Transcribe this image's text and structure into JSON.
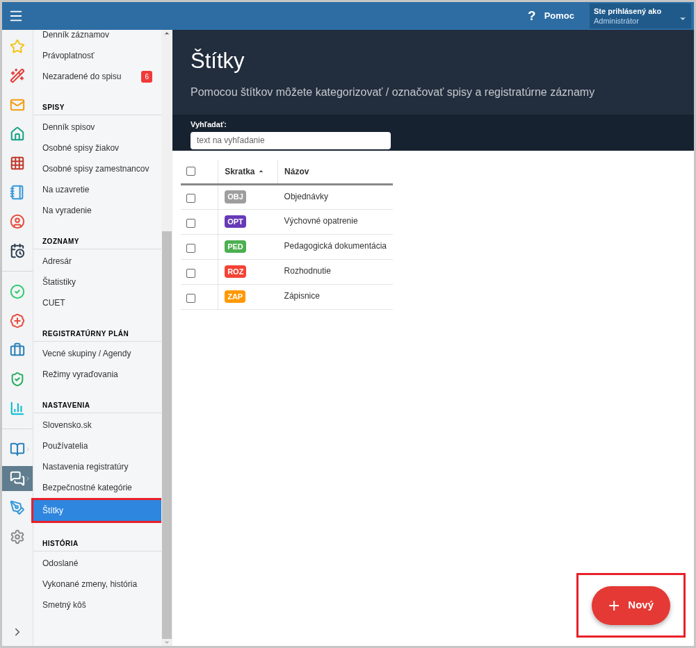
{
  "top_bar": {
    "help": {
      "icon_text": "?",
      "label": "Pomoc"
    },
    "user": {
      "caption": "Ste prihlásený ako",
      "name": "Administrátor"
    }
  },
  "rail": [
    {
      "selected": false,
      "expandable": false
    },
    {
      "selected": false,
      "expandable": false
    },
    {
      "selected": false,
      "expandable": false
    },
    {
      "selected": false,
      "expandable": false
    },
    {
      "selected": false,
      "expandable": false
    },
    {
      "selected": false,
      "expandable": false
    },
    {
      "selected": false,
      "expandable": false
    },
    {
      "selected": false,
      "expandable": false
    },
    {
      "selected": false,
      "expandable": false
    },
    {
      "selected": false,
      "expandable": false
    },
    {
      "selected": false,
      "expandable": false
    },
    {
      "selected": false,
      "expandable": false
    },
    {
      "selected": false,
      "expandable": false
    },
    {
      "selected": false,
      "expandable": true
    },
    {
      "selected": true,
      "expandable": true
    },
    {
      "selected": false,
      "expandable": false
    },
    {
      "selected": false,
      "expandable": false
    }
  ],
  "sidebar": {
    "sections": [
      {
        "items": [
          {
            "label": "Denník záznamov",
            "selected": false,
            "highlighted": false
          },
          {
            "label": "Právoplatnosť",
            "selected": false,
            "highlighted": false
          },
          {
            "label": "Nezaradené do spisu",
            "badge": "6",
            "selected": false,
            "highlighted": false
          }
        ]
      },
      {
        "title": "SPISY",
        "items": [
          {
            "label": "Denník spisov",
            "selected": false,
            "highlighted": false
          },
          {
            "label": "Osobné spisy žiakov",
            "selected": false,
            "highlighted": false
          },
          {
            "label": "Osobné spisy zamestnancov",
            "selected": false,
            "highlighted": false
          },
          {
            "label": "Na uzavretie",
            "selected": false,
            "highlighted": false
          },
          {
            "label": "Na vyradenie",
            "selected": false,
            "highlighted": false
          }
        ]
      },
      {
        "title": "ZOZNAMY",
        "items": [
          {
            "label": "Adresár",
            "selected": false,
            "highlighted": false
          },
          {
            "label": "Štatistiky",
            "selected": false,
            "highlighted": false
          },
          {
            "label": "CUET",
            "selected": false,
            "highlighted": false
          }
        ]
      },
      {
        "title": "REGISTRATÚRNY PLÁN",
        "items": [
          {
            "label": "Vecné skupiny / Agendy",
            "selected": false,
            "highlighted": false
          },
          {
            "label": "Režimy vyraďovania",
            "selected": false,
            "highlighted": false
          }
        ]
      },
      {
        "title": "NASTAVENIA",
        "items": [
          {
            "label": "Slovensko.sk",
            "selected": false,
            "highlighted": false
          },
          {
            "label": "Používatelia",
            "selected": false,
            "highlighted": false
          },
          {
            "label": "Nastavenia registratúry",
            "selected": false,
            "highlighted": false
          },
          {
            "label": "Bezpečnostné kategórie",
            "selected": false,
            "highlighted": false
          },
          {
            "label": "Štítky",
            "selected": true,
            "highlighted": true
          }
        ]
      },
      {
        "title": "HISTÓRIA",
        "items": [
          {
            "label": "Odoslané",
            "selected": false,
            "highlighted": false
          },
          {
            "label": "Vykonané zmeny, história",
            "selected": false,
            "highlighted": false
          },
          {
            "label": "Smetný kôš",
            "selected": false,
            "highlighted": false
          }
        ]
      }
    ]
  },
  "header": {
    "title": "Štítky",
    "subtitle": "Pomocou štítkov môžete kategorizovať / označovať spisy a registratúrne záznamy"
  },
  "search": {
    "label": "Vyhľadať:",
    "placeholder": "text na vyhľadanie"
  },
  "table": {
    "select_all": {
      "checked": false
    },
    "columns": [
      {
        "label": "Skratka",
        "sorted": true
      },
      {
        "label": "Názov",
        "sorted": false
      }
    ],
    "rows": [
      {
        "code": "OBJ",
        "color": "#9e9e9e",
        "name": "Objednávky",
        "checked": false
      },
      {
        "code": "OPT",
        "color": "#673ab7",
        "name": "Výchovné opatrenie",
        "checked": false
      },
      {
        "code": "PED",
        "color": "#4caf50",
        "name": "Pedagogická dokumentácia",
        "checked": false
      },
      {
        "code": "ROZ",
        "color": "#f44336",
        "name": "Rozhodnutie",
        "checked": false
      },
      {
        "code": "ZAP",
        "color": "#ff9800",
        "name": "Zápisnice",
        "checked": false
      }
    ]
  },
  "new_button": {
    "icon_text": "+",
    "label": "Nový",
    "highlighted": true
  }
}
